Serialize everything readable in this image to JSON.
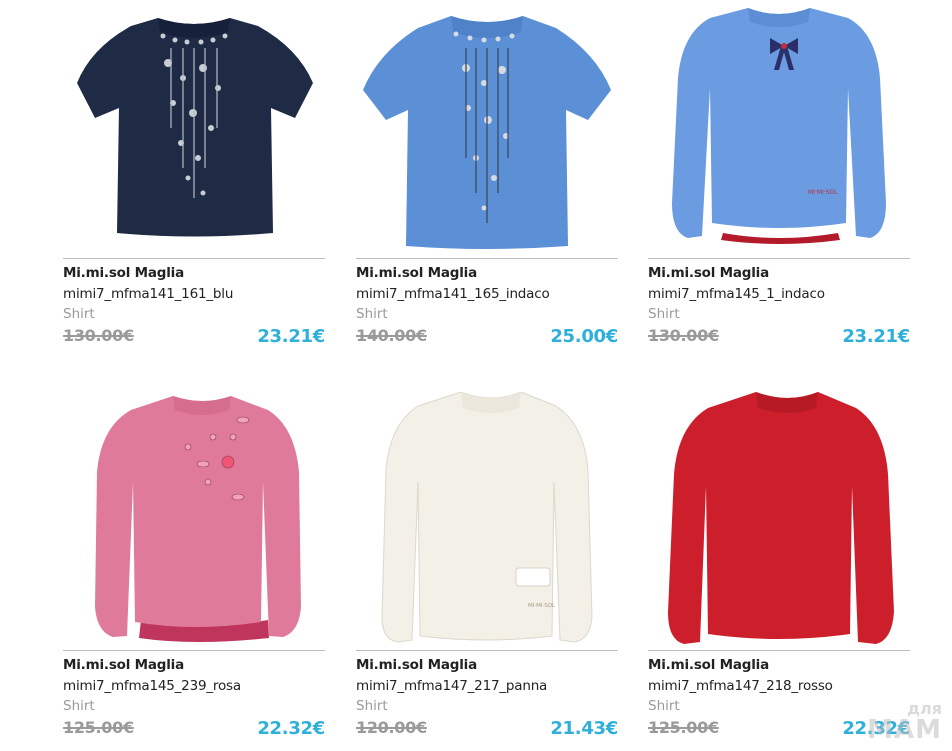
{
  "products": [
    {
      "brand": "Mi.mi.sol Maglia",
      "sku": "mimi7_mfma141_161_blu",
      "category": "Shirt",
      "old_price": "130.00€",
      "price": "23.21€",
      "image_icon": "navy-short-sleeve-sequin-sweater-image",
      "garment_color": "#1f2a44"
    },
    {
      "brand": "Mi.mi.sol Maglia",
      "sku": "mimi7_mfma141_165_indaco",
      "category": "Shirt",
      "old_price": "140.00€",
      "price": "25.00€",
      "image_icon": "blue-short-sleeve-sequin-sweater-image",
      "garment_color": "#5b8fd6"
    },
    {
      "brand": "Mi.mi.sol Maglia",
      "sku": "mimi7_mfma145_1_indaco",
      "category": "Shirt",
      "old_price": "130.00€",
      "price": "23.21€",
      "image_icon": "blue-long-sleeve-bow-sweater-image",
      "garment_color": "#6b9be0"
    },
    {
      "brand": "Mi.mi.sol Maglia",
      "sku": "mimi7_mfma145_239_rosa",
      "category": "Shirt",
      "old_price": "125.00€",
      "price": "22.32€",
      "image_icon": "pink-long-sleeve-floral-sweater-image",
      "garment_color": "#e07a9a"
    },
    {
      "brand": "Mi.mi.sol Maglia",
      "sku": "mimi7_mfma147_217_panna",
      "category": "Shirt",
      "old_price": "120.00€",
      "price": "21.43€",
      "image_icon": "cream-long-sleeve-sweater-image",
      "garment_color": "#f3f0e8"
    },
    {
      "brand": "Mi.mi.sol Maglia",
      "sku": "mimi7_mfma147_218_rosso",
      "category": "Shirt",
      "old_price": "125.00€",
      "price": "22.32€",
      "image_icon": "red-long-sleeve-sweater-image",
      "garment_color": "#cc1f2b"
    }
  ],
  "watermark": {
    "top": "для",
    "main": "MAM"
  },
  "colors": {
    "price_accent": "#2fb0db",
    "muted_text": "#9a9a9a",
    "divider": "#bdbdbd"
  }
}
